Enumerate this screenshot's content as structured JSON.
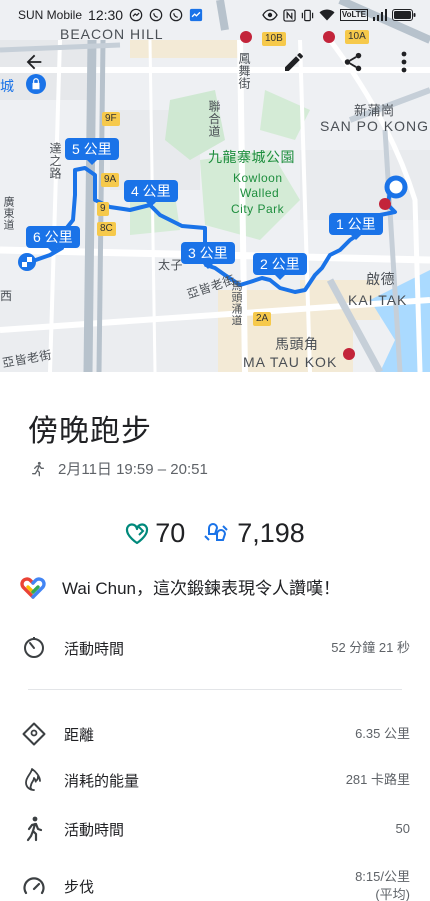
{
  "status_bar": {
    "carrier": "SUN Mobile",
    "time": "12:30",
    "volte": "VoLTE"
  },
  "map": {
    "labels": {
      "beacon_hill": "BEACON HILL",
      "san_po_kong_zh": "新蒲崗",
      "san_po_kong": "SAN PO KONG",
      "park_zh": "九龍寨城公園",
      "park_en_1": "Kowloon",
      "park_en_2": "Walled",
      "park_en_3": "City Park",
      "kai_tak_zh": "啟德",
      "kai_tak": "KAI TAK",
      "ma_tau_kok_zh": "馬頭角",
      "ma_tau_kok": "MA TAU KOK",
      "street_1": "聯合道",
      "street_2": "鳳舞街",
      "street_3": "亞皆老街",
      "street_4": "亞皆老街",
      "street_5": "太子",
      "street_6": "馬頭涌道",
      "street_7": "廣東道",
      "street_8": "西",
      "city_char": "城",
      "street_9": "達之路"
    },
    "road_tags": [
      "10B",
      "10A",
      "9F",
      "9A",
      "9",
      "8C",
      "2A"
    ],
    "km_markers": [
      "1 公里",
      "2 公里",
      "3 公里",
      "4 公里",
      "5 公里",
      "6 公里"
    ]
  },
  "activity": {
    "title": "傍晚跑步",
    "date_time": "2月11日 19:59 – 20:51",
    "heart_points": "70",
    "steps": "7,198",
    "message": "Wai Chun，這次鍛鍊表現令人讚嘆！",
    "rows": {
      "duration_label": "活動時間",
      "duration_value": "52 分鐘 21 秒",
      "distance_label": "距離",
      "distance_value": "6.35 公里",
      "energy_label": "消耗的能量",
      "energy_value": "281 卡路里",
      "active_label": "活動時間",
      "active_value": "50",
      "pace_label": "步伐",
      "pace_value_1": "8:15/公里",
      "pace_value_2": "(平均)"
    }
  },
  "colors": {
    "route": "#1a73e8",
    "heart_points": "#00897b",
    "steps": "#1a73e8"
  }
}
